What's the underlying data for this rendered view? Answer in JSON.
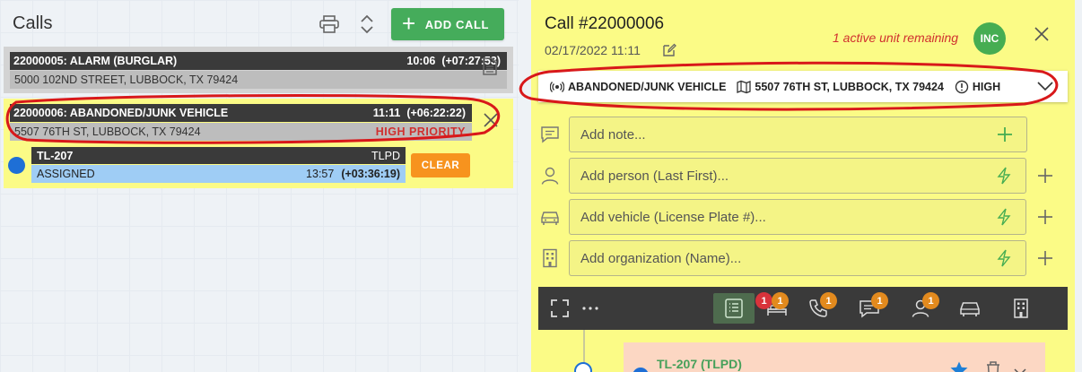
{
  "left": {
    "title": "Calls",
    "add_call_label": "ADD CALL",
    "calls": [
      {
        "id_title": "22000005: ALARM (BURGLAR)",
        "time": "10:06",
        "elapsed": "(+07:27:53)",
        "address": "5000 102ND STREET, LUBBOCK, TX 79424",
        "priority": ""
      },
      {
        "id_title": "22000006: ABANDONED/JUNK VEHICLE",
        "time": "11:11",
        "elapsed": "(+06:22:22)",
        "address": "5507 76TH ST, LUBBOCK, TX 79424",
        "priority": "HIGH PRIORITY"
      }
    ],
    "unit": {
      "name": "TL-207",
      "agency": "TLPD",
      "status": "ASSIGNED",
      "time": "13:57",
      "elapsed": "(+03:36:19)",
      "clear_label": "CLEAR"
    }
  },
  "detail": {
    "title": "Call #22000006",
    "date": "02/17/2022 11:11",
    "active_units": "1 active unit remaining",
    "status_badge": "INC",
    "summary": {
      "type": "ABANDONED/JUNK VEHICLE",
      "address": "5507 76TH ST, LUBBOCK, TX 79424",
      "priority": "HIGH"
    },
    "fields": {
      "note_placeholder": "Add note...",
      "person_placeholder": "Add person (Last First)...",
      "vehicle_placeholder": "Add vehicle (License Plate #)...",
      "organization_placeholder": "Add organization (Name)..."
    },
    "toolbar": {
      "badges": {
        "vehicles_red": "1",
        "vehicles_orange": "1",
        "calls": "1",
        "messages": "1",
        "persons": "1"
      }
    },
    "unit_card": {
      "name": "TL-207 (TLPD)"
    }
  },
  "colors": {
    "accent_green": "#45ac5b",
    "highlight_yellow": "#fbfb86",
    "priority_red": "#d0302f",
    "clear_orange": "#f7931e",
    "unit_blue": "#1e6fd6",
    "status_blue": "#9fcdf5"
  }
}
